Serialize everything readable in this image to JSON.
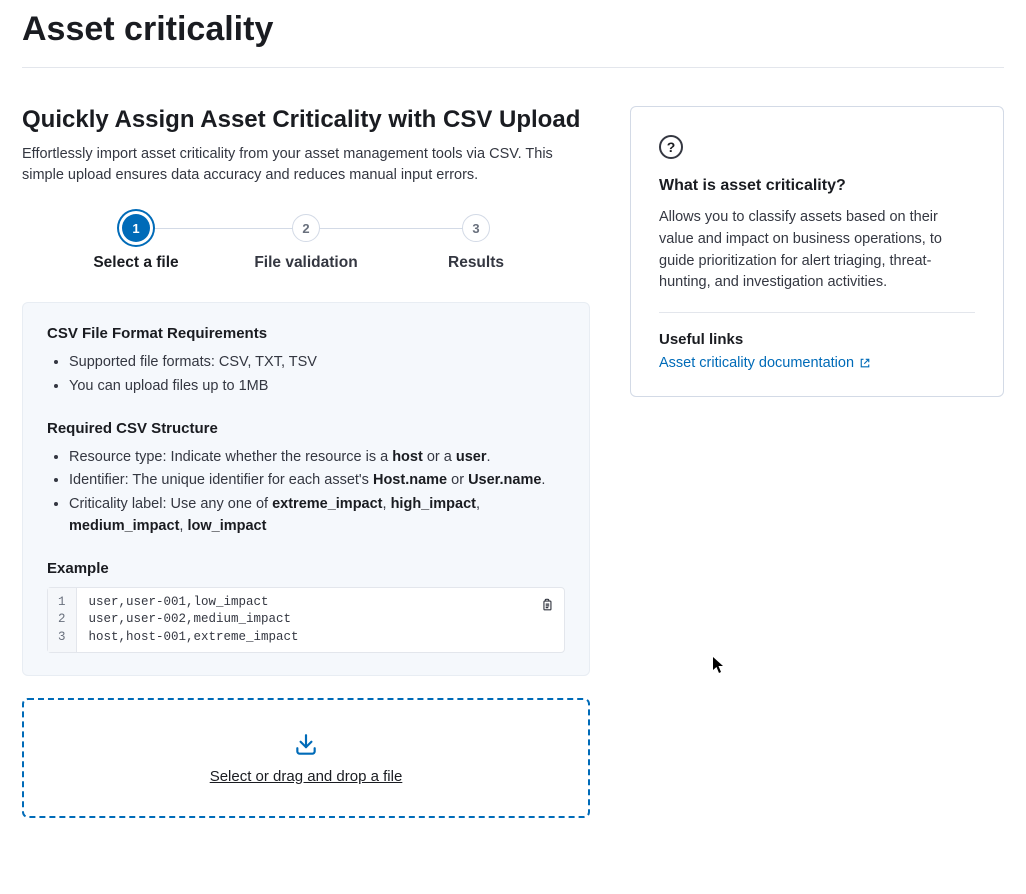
{
  "page": {
    "title": "Asset criticality"
  },
  "section": {
    "title": "Quickly Assign Asset Criticality with CSV Upload",
    "subtitle": "Effortlessly import asset criticality from your asset management tools via CSV. This simple upload ensures data accuracy and reduces manual input errors."
  },
  "stepper": {
    "steps": [
      {
        "num": "1",
        "label": "Select a file",
        "active": true
      },
      {
        "num": "2",
        "label": "File validation",
        "active": false
      },
      {
        "num": "3",
        "label": "Results",
        "active": false
      }
    ]
  },
  "requirements": {
    "heading": "CSV File Format Requirements",
    "formats_label": "Supported file formats: CSV, TXT, TSV",
    "size_label": "You can upload files up to 1MB",
    "structure_heading": "Required CSV Structure",
    "struct_resource_prefix": "Resource type: Indicate whether the resource is a ",
    "struct_resource_b1": "host",
    "struct_resource_mid": " or a ",
    "struct_resource_b2": "user",
    "struct_resource_suffix": ".",
    "struct_identifier_prefix": "Identifier: The unique identifier for each asset's ",
    "struct_identifier_b1": "Host.name",
    "struct_identifier_mid": " or ",
    "struct_identifier_b2": "User.name",
    "struct_identifier_suffix": ".",
    "struct_label_prefix": "Criticality label: Use any one of ",
    "struct_label_b1": "extreme_impact",
    "struct_label_c1": ", ",
    "struct_label_b2": "high_impact",
    "struct_label_c2": ", ",
    "struct_label_b3": "medium_impact",
    "struct_label_c3": ", ",
    "struct_label_b4": "low_impact",
    "example_heading": "Example",
    "example_gutter": "1\n2\n3",
    "example_code": "user,user-001,low_impact\nuser,user-002,medium_impact\nhost,host-001,extreme_impact"
  },
  "dropzone": {
    "label": "Select or drag and drop a file"
  },
  "sidebar": {
    "what_heading": "What is asset criticality?",
    "what_body": "Allows you to classify assets based on their value and impact on business operations, to guide prioritization for alert triaging, threat-hunting, and investigation activities.",
    "links_heading": "Useful links",
    "doc_link": "Asset criticality documentation"
  }
}
